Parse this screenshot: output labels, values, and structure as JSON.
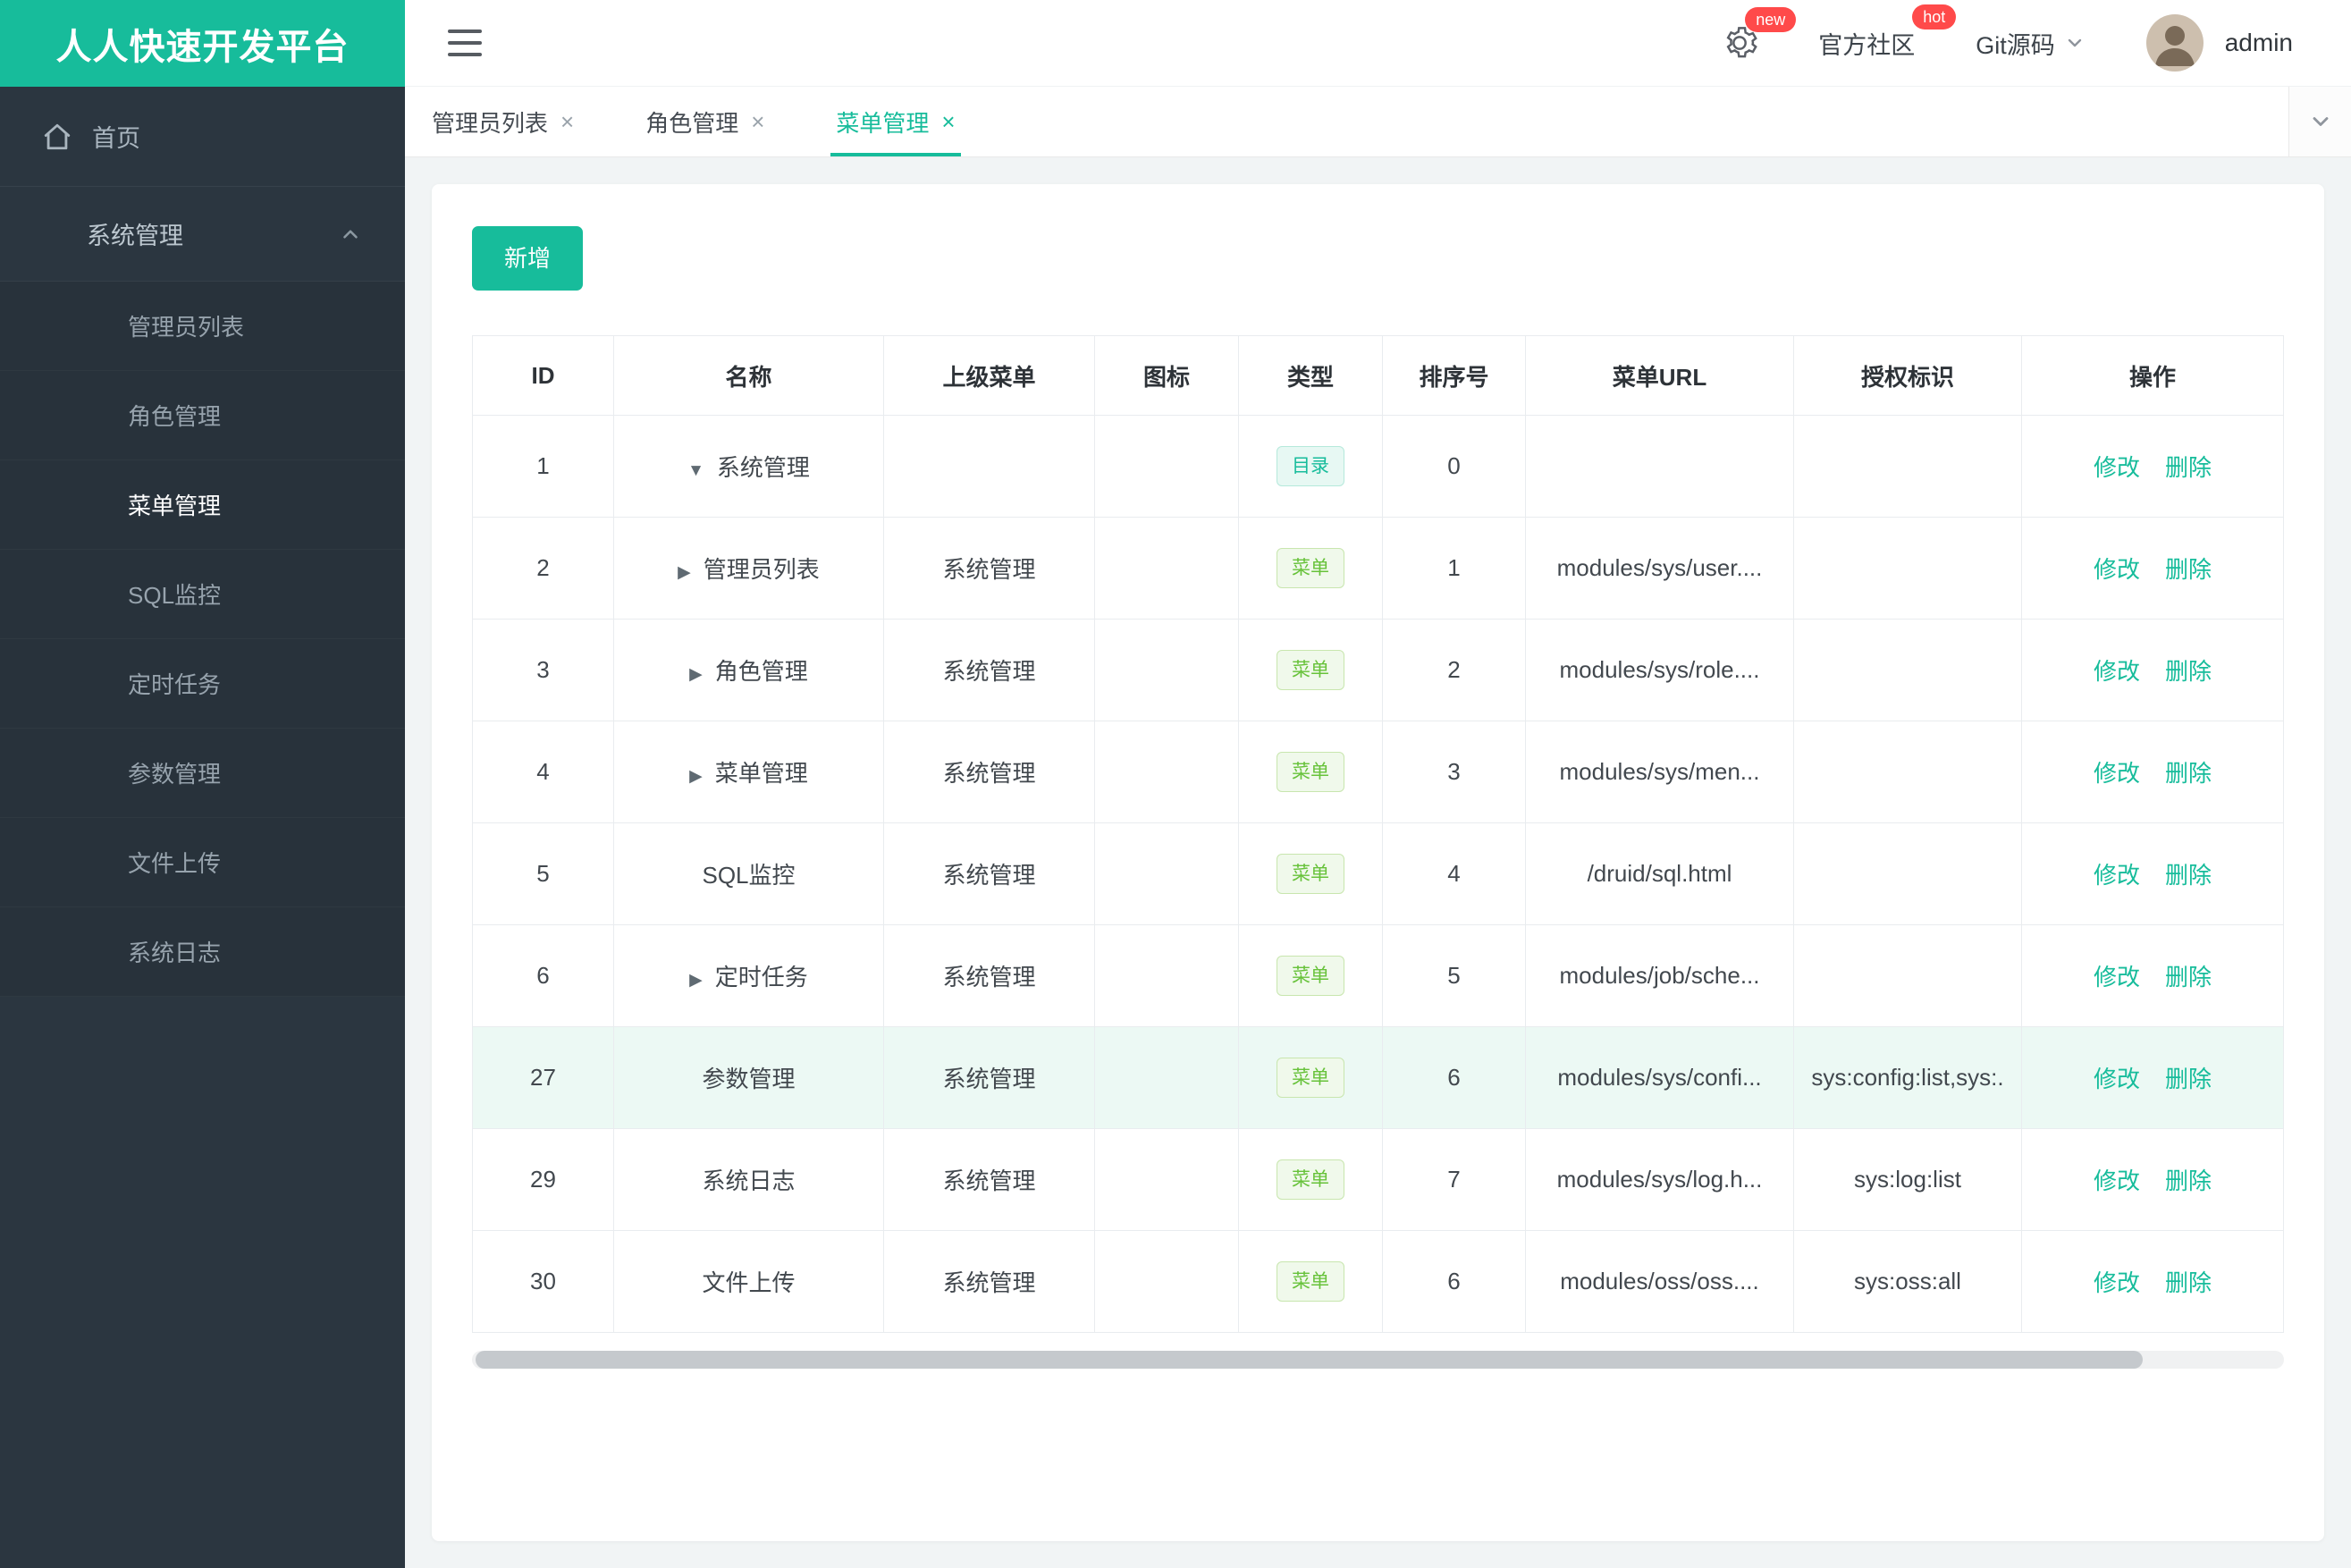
{
  "app": {
    "logo": "人人快速开发平台"
  },
  "colors": {
    "accent": "#17bc9b",
    "sidebar_bg": "#2b3640",
    "badge_red": "#ff4a4a",
    "tag_dir": "#17bc9b",
    "tag_menu": "#67c23a",
    "row_highlight": "#ecf9f4"
  },
  "icons": {
    "hamburger": "menu-toggle",
    "gear": "settings",
    "home": "house",
    "chevron_up": "collapse",
    "chevron_down": "expand",
    "close": "×",
    "arrow_down": "▼",
    "arrow_right": "▶"
  },
  "header": {
    "username": "admin",
    "new_badge": "new",
    "hot_badge": "hot",
    "community": "官方社区",
    "git": "Git源码"
  },
  "sidebar": {
    "home": "首页",
    "group": {
      "title": "系统管理",
      "items": [
        {
          "label": "管理员列表"
        },
        {
          "label": "角色管理"
        },
        {
          "label": "菜单管理",
          "active": true
        },
        {
          "label": "SQL监控"
        },
        {
          "label": "定时任务"
        },
        {
          "label": "参数管理"
        },
        {
          "label": "文件上传"
        },
        {
          "label": "系统日志"
        }
      ]
    }
  },
  "tabs": [
    {
      "label": "管理员列表"
    },
    {
      "label": "角色管理"
    },
    {
      "label": "菜单管理",
      "active": true
    }
  ],
  "toolbar": {
    "add_label": "新增"
  },
  "table": {
    "headers": [
      "ID",
      "名称",
      "上级菜单",
      "图标",
      "类型",
      "排序号",
      "菜单URL",
      "授权标识",
      "操作"
    ],
    "actions": {
      "edit": "修改",
      "delete": "删除"
    },
    "rows": [
      {
        "id": "1",
        "arrow": "▼",
        "name": "系统管理",
        "parent": "",
        "type": "目录",
        "order": "0",
        "url": "",
        "perm": ""
      },
      {
        "id": "2",
        "arrow": "▶",
        "name": "管理员列表",
        "parent": "系统管理",
        "type": "菜单",
        "order": "1",
        "url": "modules/sys/user....",
        "perm": ""
      },
      {
        "id": "3",
        "arrow": "▶",
        "name": "角色管理",
        "parent": "系统管理",
        "type": "菜单",
        "order": "2",
        "url": "modules/sys/role....",
        "perm": ""
      },
      {
        "id": "4",
        "arrow": "▶",
        "name": "菜单管理",
        "parent": "系统管理",
        "type": "菜单",
        "order": "3",
        "url": "modules/sys/men...",
        "perm": ""
      },
      {
        "id": "5",
        "arrow": "",
        "name": "SQL监控",
        "parent": "系统管理",
        "type": "菜单",
        "order": "4",
        "url": "/druid/sql.html",
        "perm": ""
      },
      {
        "id": "6",
        "arrow": "▶",
        "name": "定时任务",
        "parent": "系统管理",
        "type": "菜单",
        "order": "5",
        "url": "modules/job/sche...",
        "perm": ""
      },
      {
        "id": "27",
        "arrow": "",
        "name": "参数管理",
        "parent": "系统管理",
        "type": "菜单",
        "order": "6",
        "url": "modules/sys/confi...",
        "perm": "sys:config:list,sys:.",
        "highlighted": true
      },
      {
        "id": "29",
        "arrow": "",
        "name": "系统日志",
        "parent": "系统管理",
        "type": "菜单",
        "order": "7",
        "url": "modules/sys/log.h...",
        "perm": "sys:log:list"
      },
      {
        "id": "30",
        "arrow": "",
        "name": "文件上传",
        "parent": "系统管理",
        "type": "菜单",
        "order": "6",
        "url": "modules/oss/oss....",
        "perm": "sys:oss:all"
      }
    ]
  }
}
